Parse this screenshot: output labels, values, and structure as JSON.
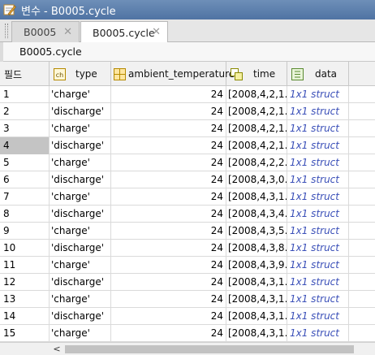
{
  "window": {
    "title": "변수 - B0005.cycle"
  },
  "tabs": [
    {
      "label": "B0005",
      "close": "✕"
    },
    {
      "label": "B0005.cycle",
      "close": "✕"
    }
  ],
  "path": {
    "label": "B0005.cycle"
  },
  "table": {
    "columns": [
      {
        "label": "필드"
      },
      {
        "label": "type",
        "icon": "char-icon"
      },
      {
        "label": "ambient_temperature",
        "icon": "numeric-icon"
      },
      {
        "label": "time",
        "icon": "cell-array-icon"
      },
      {
        "label": "data",
        "icon": "struct-icon"
      }
    ],
    "rows": [
      {
        "index": "1",
        "type": "'charge'",
        "ambient_temperature": "24",
        "time": "[2008,4,2,1...",
        "data": "1x1 struct"
      },
      {
        "index": "2",
        "type": "'discharge'",
        "ambient_temperature": "24",
        "time": "[2008,4,2,1...",
        "data": "1x1 struct"
      },
      {
        "index": "3",
        "type": "'charge'",
        "ambient_temperature": "24",
        "time": "[2008,4,2,1...",
        "data": "1x1 struct"
      },
      {
        "index": "4",
        "type": "'discharge'",
        "ambient_temperature": "24",
        "time": "[2008,4,2,1...",
        "data": "1x1 struct"
      },
      {
        "index": "5",
        "type": "'charge'",
        "ambient_temperature": "24",
        "time": "[2008,4,2,2...",
        "data": "1x1 struct"
      },
      {
        "index": "6",
        "type": "'discharge'",
        "ambient_temperature": "24",
        "time": "[2008,4,3,0...",
        "data": "1x1 struct"
      },
      {
        "index": "7",
        "type": "'charge'",
        "ambient_temperature": "24",
        "time": "[2008,4,3,1...",
        "data": "1x1 struct"
      },
      {
        "index": "8",
        "type": "'discharge'",
        "ambient_temperature": "24",
        "time": "[2008,4,3,4...",
        "data": "1x1 struct"
      },
      {
        "index": "9",
        "type": "'charge'",
        "ambient_temperature": "24",
        "time": "[2008,4,3,5...",
        "data": "1x1 struct"
      },
      {
        "index": "10",
        "type": "'discharge'",
        "ambient_temperature": "24",
        "time": "[2008,4,3,8...",
        "data": "1x1 struct"
      },
      {
        "index": "11",
        "type": "'charge'",
        "ambient_temperature": "24",
        "time": "[2008,4,3,9...",
        "data": "1x1 struct"
      },
      {
        "index": "12",
        "type": "'discharge'",
        "ambient_temperature": "24",
        "time": "[2008,4,3,1...",
        "data": "1x1 struct"
      },
      {
        "index": "13",
        "type": "'charge'",
        "ambient_temperature": "24",
        "time": "[2008,4,3,1...",
        "data": "1x1 struct"
      },
      {
        "index": "14",
        "type": "'discharge'",
        "ambient_temperature": "24",
        "time": "[2008,4,3,1...",
        "data": "1x1 struct"
      },
      {
        "index": "15",
        "type": "'charge'",
        "ambient_temperature": "24",
        "time": "[2008,4,3,1...",
        "data": "1x1 struct"
      }
    ],
    "selected_index": "4"
  },
  "scrollbar": {
    "left_arrow": "<"
  },
  "colors": {
    "title_bar": "#5a7cab",
    "struct_text": "#3a4fb8",
    "selected_row_header": "#c4c4c4"
  }
}
